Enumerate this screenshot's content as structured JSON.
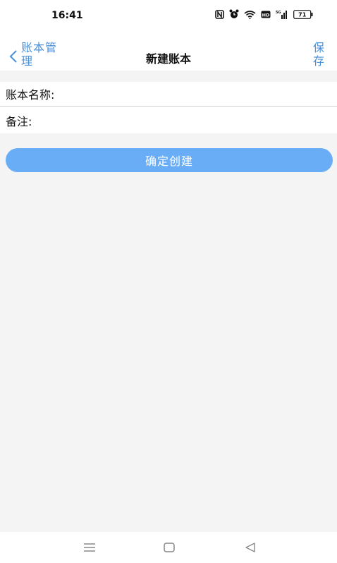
{
  "status_bar": {
    "time": "16:41",
    "battery_level": "71",
    "icons": [
      "nfc-icon",
      "alarm-icon",
      "wifi-icon",
      "hd-icon",
      "signal-icon",
      "battery-icon"
    ]
  },
  "nav": {
    "back_label": "账本管理",
    "title": "新建账本",
    "save_label": "保存"
  },
  "form": {
    "name_label": "账本名称:",
    "name_value": "",
    "note_label": "备注:",
    "note_value": ""
  },
  "actions": {
    "create_label": "确定创建"
  },
  "colors": {
    "accent": "#4a90d9",
    "button": "#68adf6",
    "background": "#f4f4f5"
  },
  "system_nav": {
    "icons": [
      "menu-icon",
      "home-icon",
      "back-icon"
    ]
  }
}
